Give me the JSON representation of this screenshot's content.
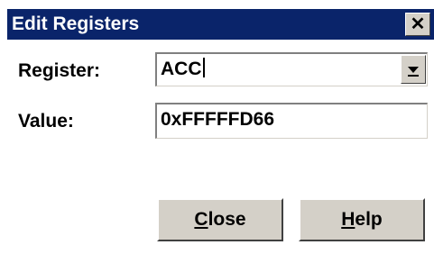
{
  "dialog": {
    "title": "Edit Registers",
    "close_glyph": "✕"
  },
  "register": {
    "label": "Register:",
    "value": "ACC"
  },
  "value_field": {
    "label": "Value:",
    "value": "0xFFFFFD66"
  },
  "buttons": {
    "close_label": "Close",
    "help_label": "Help"
  },
  "colors": {
    "titlebar": "#0a246a",
    "face": "#d4d0c8",
    "background": "#ffffff"
  }
}
